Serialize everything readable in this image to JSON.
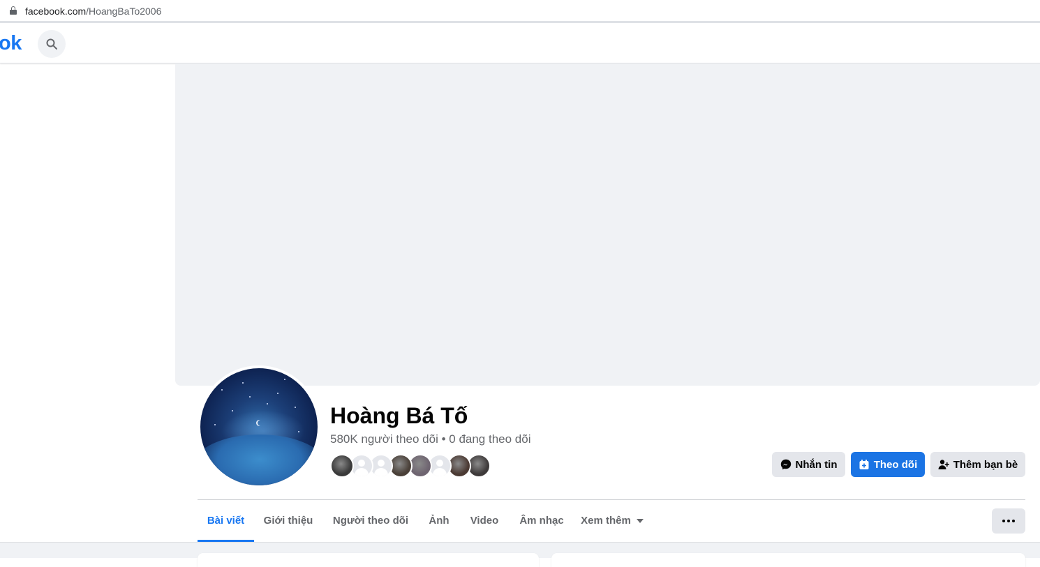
{
  "browser": {
    "url_host": "facebook.com",
    "url_path": "/HoangBaTo2006"
  },
  "topnav": {
    "logo_text": "ok",
    "search_icon": "search-icon"
  },
  "profile": {
    "name": "Hoàng Bá Tố",
    "followers": "580K người theo dõi",
    "separator": " • ",
    "following": "0 đang theo dõi",
    "follower_faces": [
      {
        "type": "photo",
        "color": "#3a3a3a"
      },
      {
        "type": "blank"
      },
      {
        "type": "blank"
      },
      {
        "type": "photo",
        "color": "#4a4038"
      },
      {
        "type": "photo",
        "color": "#6e6470"
      },
      {
        "type": "blank"
      },
      {
        "type": "photo",
        "color": "#4b3a33"
      },
      {
        "type": "photo",
        "color": "#3e3a3a"
      }
    ]
  },
  "actions": {
    "message": "Nhắn tin",
    "follow": "Theo dõi",
    "add_friend": "Thêm bạn bè"
  },
  "tabs": [
    {
      "label": "Bài viết",
      "active": true
    },
    {
      "label": "Giới thiệu",
      "active": false
    },
    {
      "label": "Người theo dõi",
      "active": false
    },
    {
      "label": "Ảnh",
      "active": false
    },
    {
      "label": "Video",
      "active": false
    },
    {
      "label": "Âm nhạc",
      "active": false
    },
    {
      "label": "Xem thêm",
      "active": false,
      "dropdown": true
    }
  ],
  "colors": {
    "brand_blue": "#1877f2",
    "button_blue": "#1b74e4",
    "secondary_text": "#65676b",
    "button_gray": "#e4e6eb",
    "cover_bg": "#f0f2f5"
  }
}
